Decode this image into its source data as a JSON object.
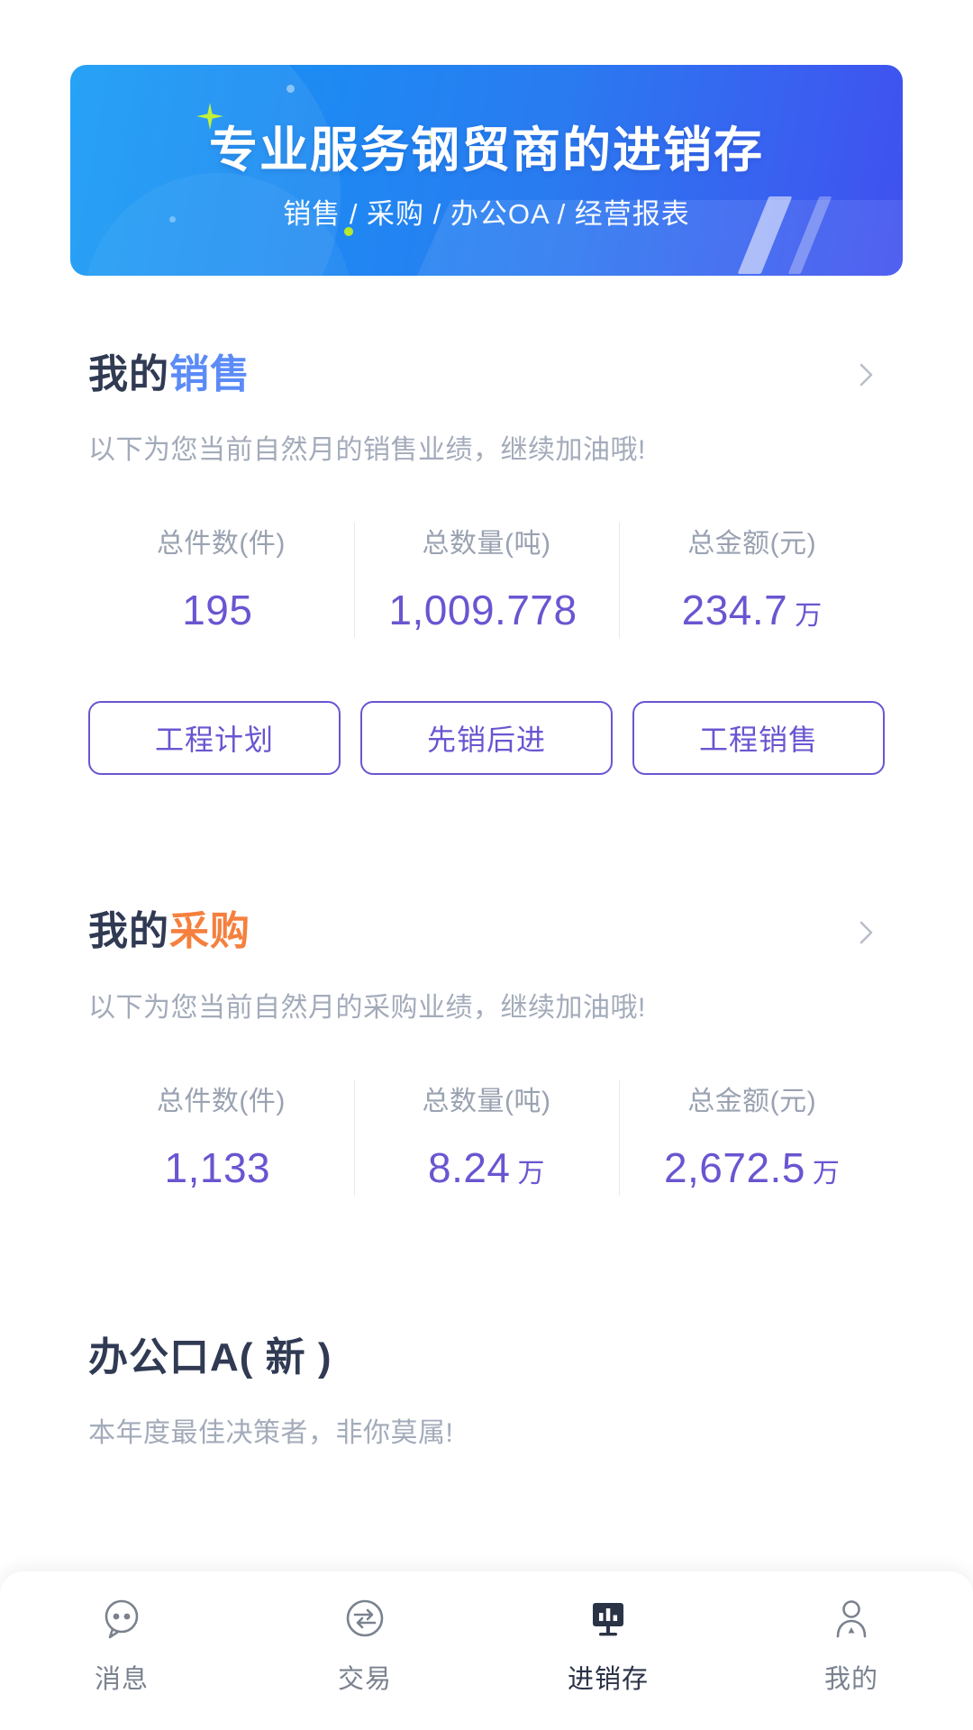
{
  "banner": {
    "title": "专业服务钢贸商的进销存",
    "subtitle": "销售 / 采购 / 办公OA / 经营报表",
    "gradient_from": "#179bf5",
    "gradient_to": "#4050ee",
    "sparkle_color": "#c2f03a"
  },
  "sales": {
    "title_prefix": "我的",
    "title_accent": "销售",
    "accent_color": "#5b8bf7",
    "description": "以下为您当前自然月的销售业绩，继续加油哦!",
    "chevron_icon": "chevron-right-icon",
    "stats": [
      {
        "label": "总件数(件)",
        "value": "195",
        "unit": ""
      },
      {
        "label": "总数量(吨)",
        "value": "1,009.778",
        "unit": ""
      },
      {
        "label": "总金额(元)",
        "value": "234.7",
        "unit": "万"
      }
    ],
    "buttons": [
      "工程计划",
      "先销后进",
      "工程销售"
    ]
  },
  "purchase": {
    "title_prefix": "我的",
    "title_accent": "采购",
    "accent_color": "#f5803e",
    "description": "以下为您当前自然月的采购业绩，继续加油哦!",
    "chevron_icon": "chevron-right-icon",
    "stats": [
      {
        "label": "总件数(件)",
        "value": "1,133",
        "unit": ""
      },
      {
        "label": "总数量(吨)",
        "value": "8.24",
        "unit": "万"
      },
      {
        "label": "总金额(元)",
        "value": "2,672.5",
        "unit": "万"
      }
    ]
  },
  "oa": {
    "title": "办公口A( 新 )",
    "description": "本年度最佳决策者，非你莫属!"
  },
  "tabbar": {
    "items": [
      {
        "label": "消息",
        "icon": "message-face-icon",
        "active": false
      },
      {
        "label": "交易",
        "icon": "exchange-arrows-icon",
        "active": false
      },
      {
        "label": "进销存",
        "icon": "bar-chart-monitor-icon",
        "active": true
      },
      {
        "label": "我的",
        "icon": "user-profile-icon",
        "active": false
      }
    ],
    "active_color": "#2b3347",
    "inactive_color": "#7a828f"
  }
}
